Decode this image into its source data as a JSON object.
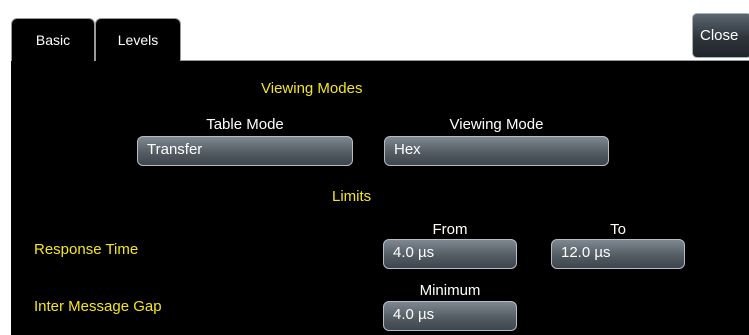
{
  "tabs": [
    {
      "label": "Basic",
      "active": true
    },
    {
      "label": "Levels",
      "active": false
    }
  ],
  "close_label": "Close",
  "viewing_modes": {
    "title": "Viewing Modes",
    "table_mode": {
      "label": "Table Mode",
      "value": "Transfer"
    },
    "viewing_mode": {
      "label": "Viewing Mode",
      "value": "Hex"
    }
  },
  "limits": {
    "title": "Limits",
    "response_time": {
      "label": "Response Time",
      "from_label": "From",
      "from_value": "4.0 µs",
      "to_label": "To",
      "to_value": "12.0 µs"
    },
    "inter_message_gap": {
      "label": "Inter Message Gap",
      "minimum_label": "Minimum",
      "minimum_value": "4.0 µs"
    }
  },
  "colors": {
    "background": "#000000",
    "label_yellow": "#f5e61c",
    "text_white": "#ffffff",
    "field_gray": "#5f676f"
  }
}
